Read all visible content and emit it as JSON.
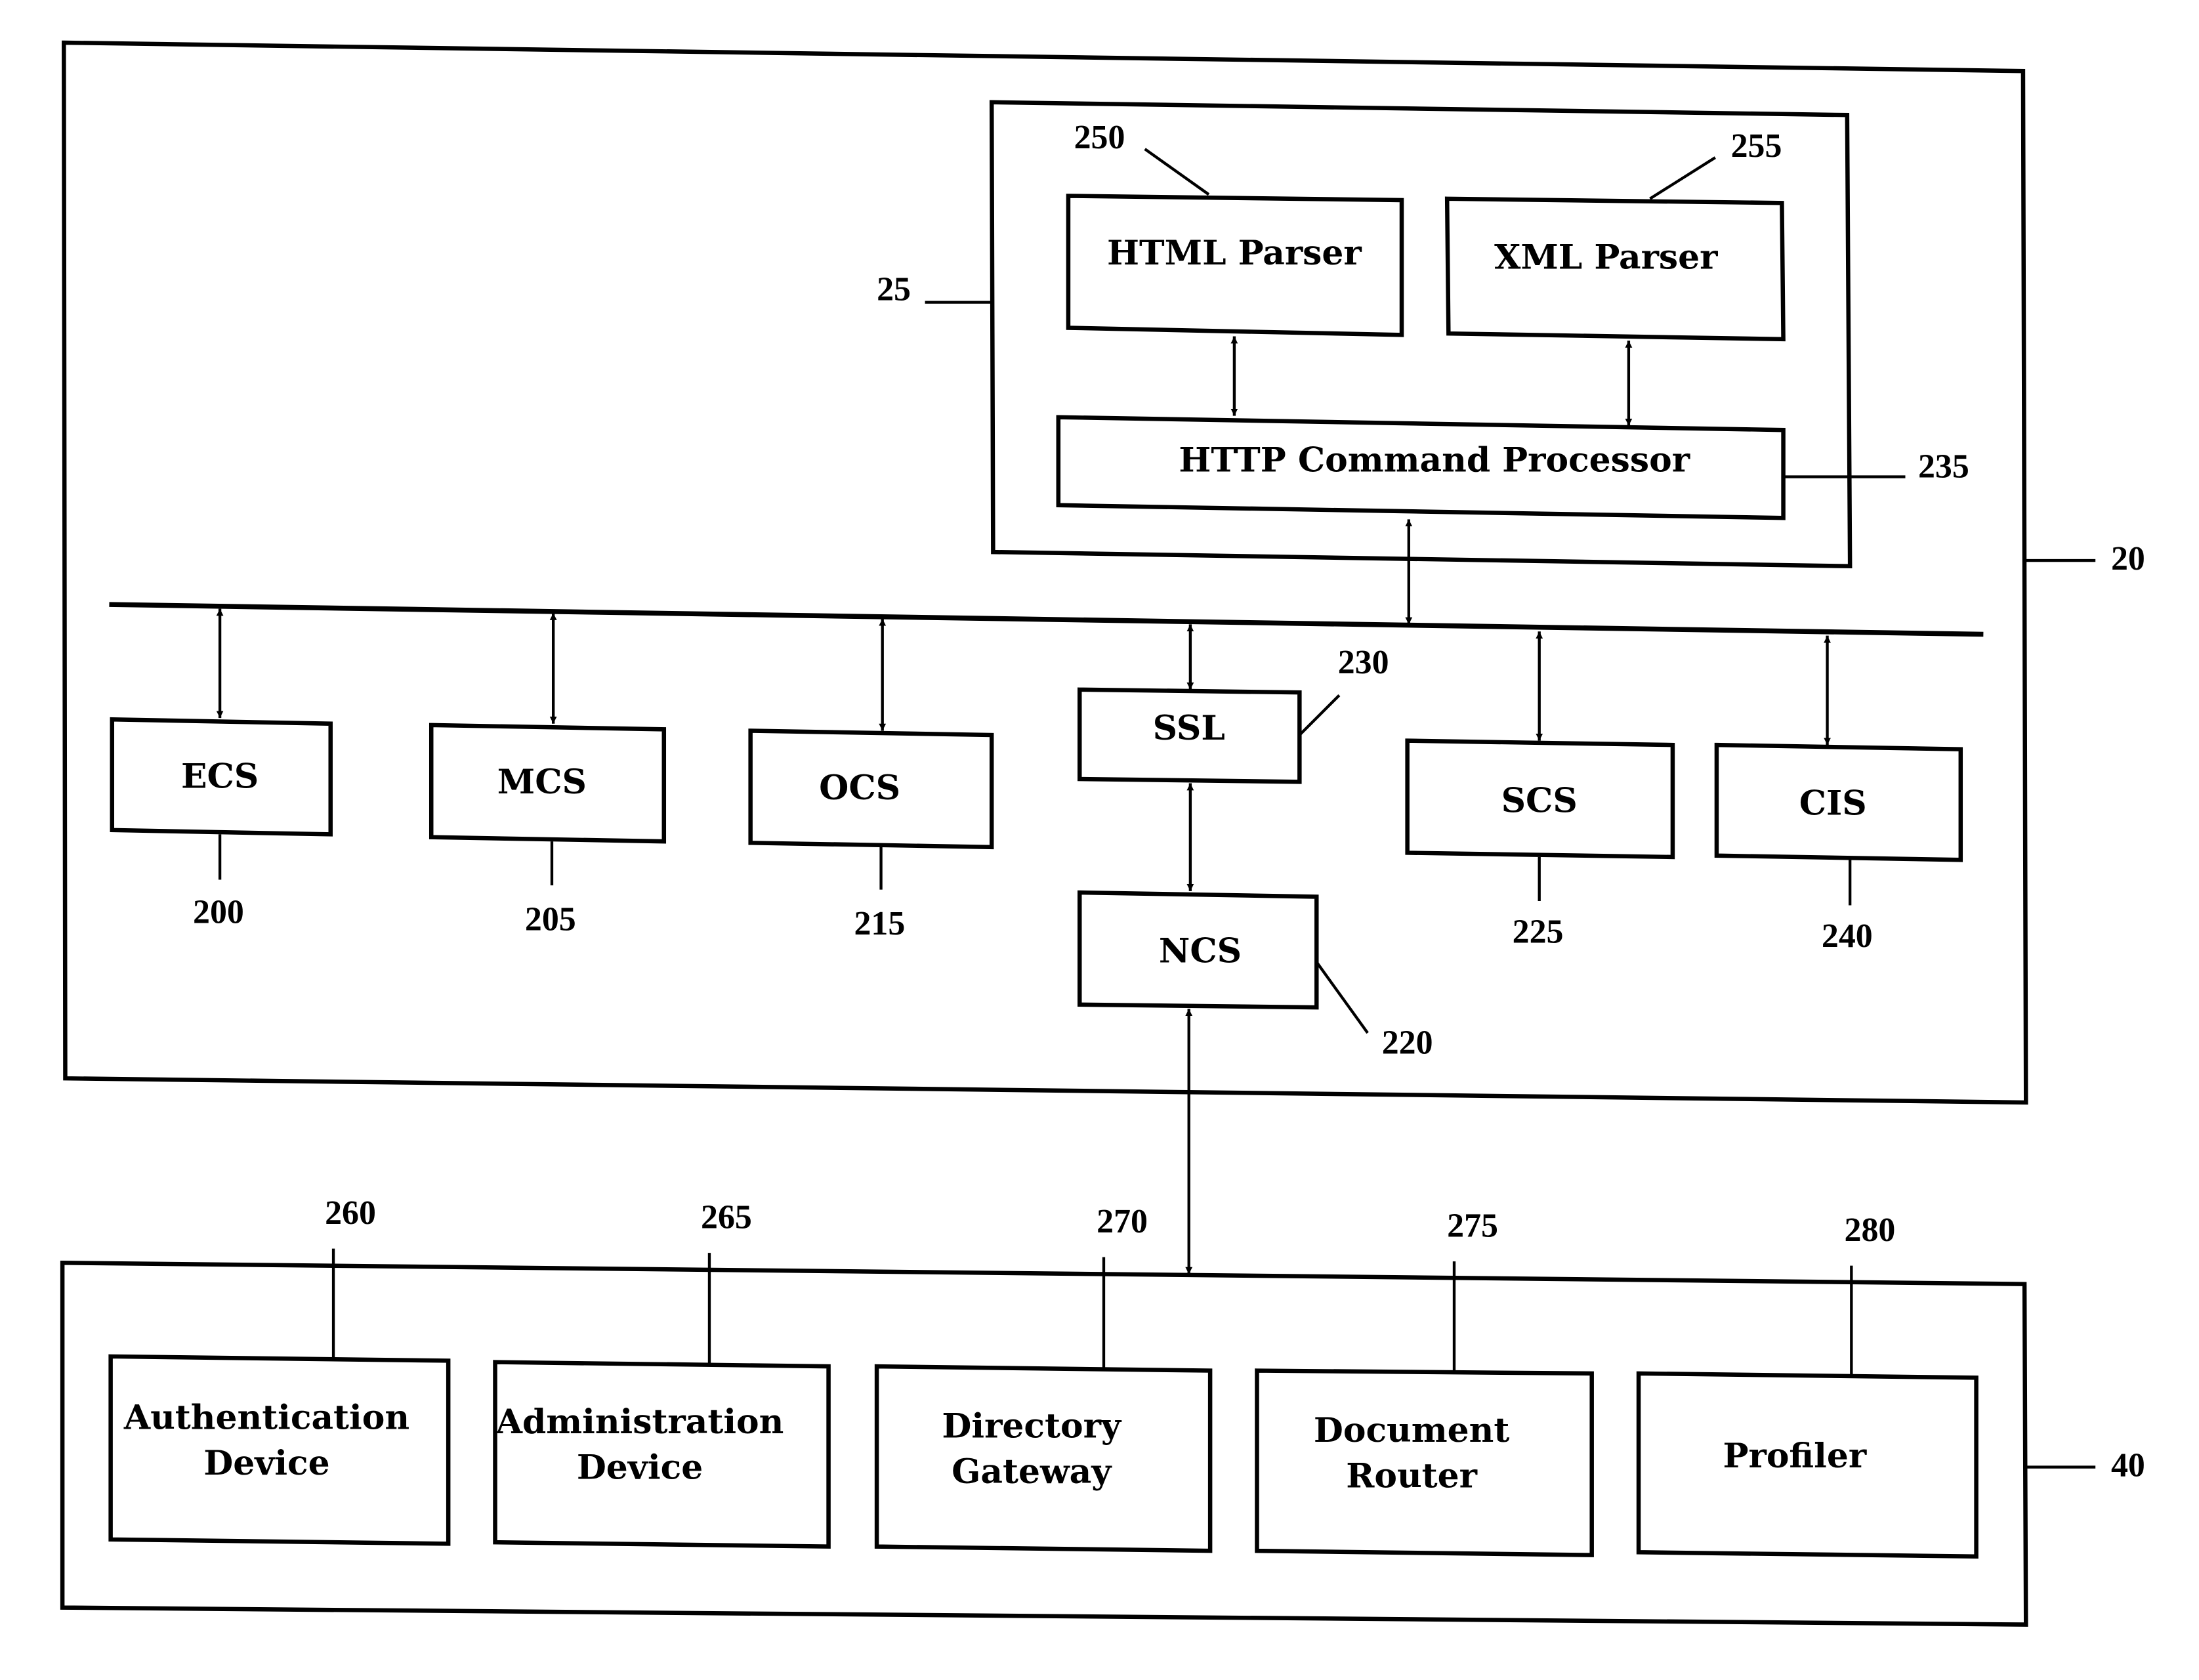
{
  "diagram": {
    "system_ref": "20",
    "gateway_ref": "25",
    "devices_ref": "40",
    "gateway": {
      "html_parser": {
        "label": "HTML Parser",
        "ref": "250"
      },
      "xml_parser": {
        "label": "XML Parser",
        "ref": "255"
      },
      "http_processor": {
        "label": "HTTP Command Processor",
        "ref": "235"
      }
    },
    "modules": [
      {
        "label": "ECS",
        "ref": "200"
      },
      {
        "label": "MCS",
        "ref": "205"
      },
      {
        "label": "OCS",
        "ref": "215"
      },
      {
        "label": "SSL",
        "ref": "230"
      },
      {
        "label": "NCS",
        "ref": "220"
      },
      {
        "label": "SCS",
        "ref": "225"
      },
      {
        "label": "CIS",
        "ref": "240"
      }
    ],
    "devices": [
      {
        "line1": "Authentication",
        "line2": "Device",
        "ref": "260"
      },
      {
        "line1": "Administration",
        "line2": "Device",
        "ref": "265"
      },
      {
        "line1": "Directory",
        "line2": "Gateway",
        "ref": "270"
      },
      {
        "line1": "Document",
        "line2": "Router",
        "ref": "275"
      },
      {
        "line1": "Profiler",
        "line2": "",
        "ref": "280"
      }
    ]
  }
}
